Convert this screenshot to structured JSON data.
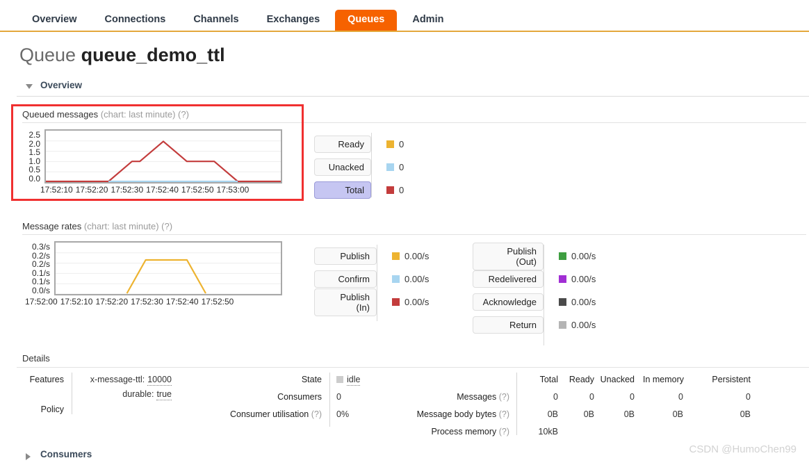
{
  "nav": {
    "items": [
      {
        "label": "Overview",
        "active": false
      },
      {
        "label": "Connections",
        "active": false
      },
      {
        "label": "Channels",
        "active": false
      },
      {
        "label": "Exchanges",
        "active": false
      },
      {
        "label": "Queues",
        "active": true
      },
      {
        "label": "Admin",
        "active": false
      }
    ]
  },
  "page": {
    "title_prefix": "Queue",
    "title_name": "queue_demo_ttl"
  },
  "sections": {
    "overview": {
      "label": "Overview",
      "expanded": true
    },
    "consumers": {
      "label": "Consumers",
      "expanded": false
    }
  },
  "queued_messages": {
    "title": "Queued messages",
    "subtitle": "(chart: last minute)",
    "help": "(?)",
    "legend": [
      {
        "label": "Ready",
        "value": "0",
        "color": "#edb330",
        "active": false
      },
      {
        "label": "Unacked",
        "value": "0",
        "color": "#a8d5f0",
        "active": false
      },
      {
        "label": "Total",
        "value": "0",
        "color": "#c33c3c",
        "active": true
      }
    ]
  },
  "message_rates": {
    "title": "Message rates",
    "subtitle": "(chart: last minute)",
    "help": "(?)",
    "legend_left": [
      {
        "label": "Publish",
        "value": "0.00/s",
        "color": "#edb330",
        "active": false
      },
      {
        "label": "Confirm",
        "value": "0.00/s",
        "color": "#a8d5f0",
        "active": false
      },
      {
        "label": "Publish\n(In)",
        "value": "0.00/s",
        "color": "#c33c3c",
        "active": false
      }
    ],
    "legend_right": [
      {
        "label": "Publish\n(Out)",
        "value": "0.00/s",
        "color": "#3e9e41",
        "active": false
      },
      {
        "label": "Redelivered",
        "value": "0.00/s",
        "color": "#a12ed4",
        "active": false
      },
      {
        "label": "Acknowledge",
        "value": "0.00/s",
        "color": "#4a4a4a",
        "active": false
      },
      {
        "label": "Return",
        "value": "0.00/s",
        "color": "#b4b4b4",
        "active": false
      }
    ]
  },
  "chart_data": [
    {
      "type": "line",
      "title": "Queued messages",
      "name": "queued-messages-chart",
      "xlabel": "",
      "ylabel": "",
      "ylim": [
        0,
        2.5
      ],
      "yticks": [
        "2.5",
        "2.0",
        "1.5",
        "1.0",
        "0.5",
        "0.0"
      ],
      "xticks": [
        "17:52:10",
        "17:52:20",
        "17:52:30",
        "17:52:40",
        "17:52:50",
        "17:53:00"
      ],
      "x_range": [
        "17:52:05",
        "17:53:05"
      ],
      "grid": true,
      "legend_position": "right",
      "series": [
        {
          "name": "Total",
          "color": "#c33c3c",
          "x": [
            "17:52:05",
            "17:52:21",
            "17:52:27",
            "17:52:29",
            "17:52:35",
            "17:52:41",
            "17:52:48",
            "17:52:54",
            "17:53:05"
          ],
          "values": [
            0,
            0,
            1,
            1,
            2,
            1,
            1,
            0,
            0
          ]
        },
        {
          "name": "Unacked",
          "color": "#a8d5f0",
          "x": [
            "17:52:21",
            "17:52:54"
          ],
          "values": [
            0,
            0
          ]
        }
      ]
    },
    {
      "type": "line",
      "title": "Message rates",
      "name": "message-rates-chart",
      "xlabel": "",
      "ylabel": "",
      "ylim": [
        0,
        0.3
      ],
      "yticks": [
        "0.3/s",
        "0.2/s",
        "0.2/s",
        "0.1/s",
        "0.1/s",
        "0.0/s"
      ],
      "xticks": [
        "17:52:00",
        "17:52:10",
        "17:52:20",
        "17:52:30",
        "17:52:40",
        "17:52:50"
      ],
      "x_range": [
        "17:51:57",
        "17:52:57"
      ],
      "grid": true,
      "legend_position": "right",
      "series": [
        {
          "name": "Publish",
          "color": "#edb330",
          "x": [
            "17:52:16",
            "17:52:21",
            "17:52:32",
            "17:52:37"
          ],
          "values": [
            0,
            0.2,
            0.2,
            0
          ]
        }
      ]
    }
  ],
  "details": {
    "heading": "Details",
    "features_label": "Features",
    "features": [
      {
        "key": "x-message-ttl:",
        "value": "10000"
      },
      {
        "key": "durable:",
        "value": "true"
      }
    ],
    "policy_label": "Policy",
    "policy_value": "",
    "state_label": "State",
    "state_value": "idle",
    "consumers_label": "Consumers",
    "consumers_value": "0",
    "consumer_util_label": "Consumer utilisation",
    "consumer_util_help": "(?)",
    "consumer_util_value": "0%",
    "stats": {
      "columns": [
        "Total",
        "Ready",
        "Unacked",
        "In memory",
        "Persistent"
      ],
      "rows": [
        {
          "label": "Messages",
          "help": "(?)",
          "values": [
            "0",
            "0",
            "0",
            "0",
            "0"
          ]
        },
        {
          "label": "Message body bytes",
          "help": "(?)",
          "values": [
            "0B",
            "0B",
            "0B",
            "0B",
            "0B"
          ]
        },
        {
          "label": "Process memory",
          "help": "(?)",
          "values": [
            "10kB",
            "",
            "",
            "",
            ""
          ]
        }
      ]
    }
  },
  "watermark": "CSDN @HumoChen99"
}
